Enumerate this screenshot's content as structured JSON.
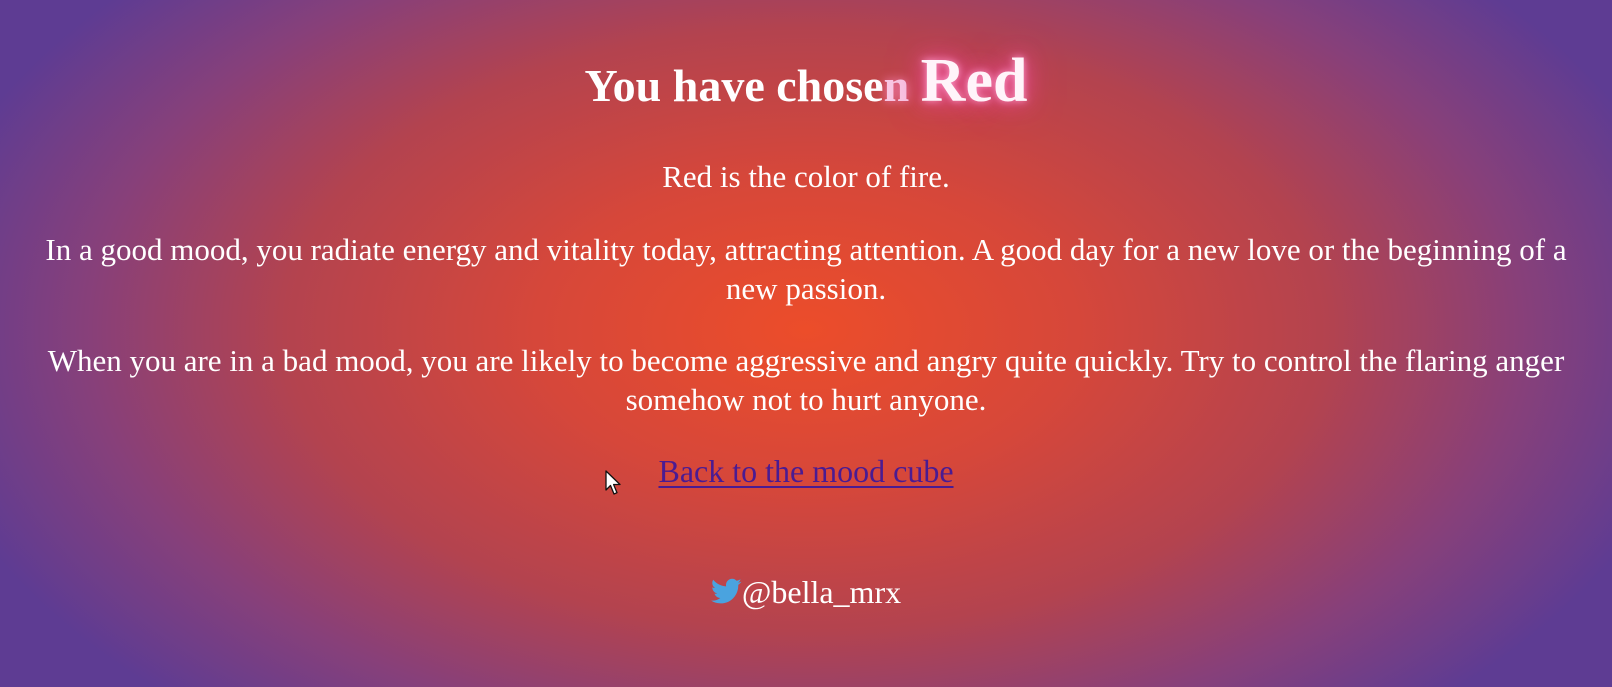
{
  "header": {
    "title_prefix": "You have chose",
    "title_glow_letter": "n",
    "title_color_word": "Red"
  },
  "content": {
    "paragraphs": [
      "Red is the color of fire.",
      "In a good mood, you radiate energy and vitality today, attracting attention. A good day for a new love or the beginning of a new passion.",
      "When you are in a bad mood, you are likely to become aggressive and angry quite quickly. Try to control the flaring anger somehow not to hurt anyone."
    ],
    "back_link_label": "Back to the mood cube"
  },
  "footer": {
    "handle": "@bella_mrx",
    "icon": "twitter-bird-icon"
  },
  "colors": {
    "background_center": "#ec4d2a",
    "background_edge": "#5e3c93",
    "link": "#4a1b92",
    "twitter_blue": "#4aa3df",
    "text": "#ffffff"
  }
}
